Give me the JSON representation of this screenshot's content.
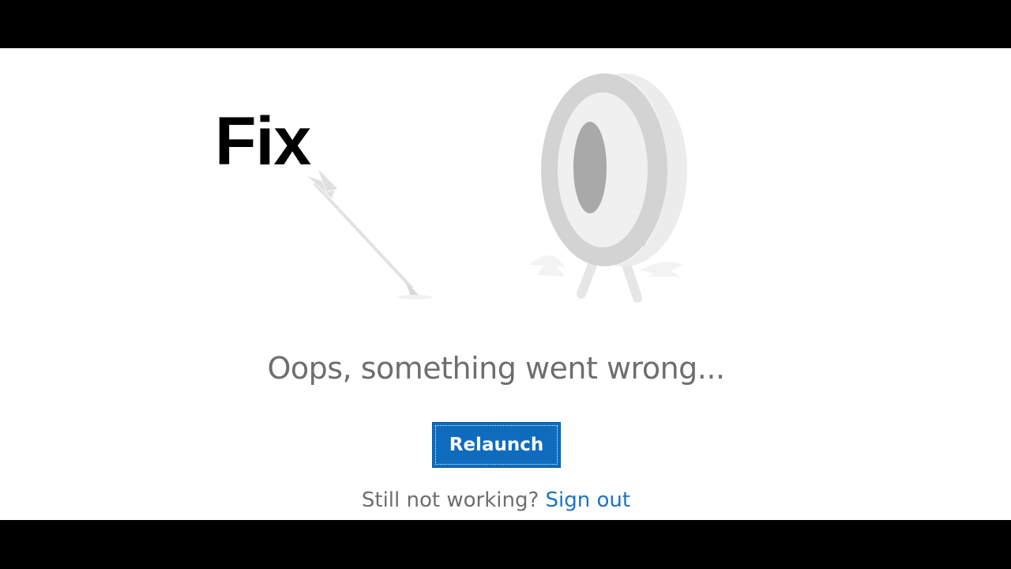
{
  "overlay": {
    "caption": "Fix"
  },
  "error": {
    "title": "Oops, something went wrong...",
    "relaunch_label": "Relaunch",
    "help_prefix": "Still not working?",
    "sign_out_label": "Sign out"
  },
  "illustration": {
    "subject": "target-with-arrow",
    "colors": {
      "outer_ring": "#d3d3d3",
      "inner_ring": "#f0f0f0",
      "bullseye": "#a9a9a9",
      "arrow": "#e2e2e2"
    }
  },
  "colors": {
    "accent": "#0f6cbd",
    "link": "#1a73c7",
    "text_muted": "#6e6e6e"
  }
}
